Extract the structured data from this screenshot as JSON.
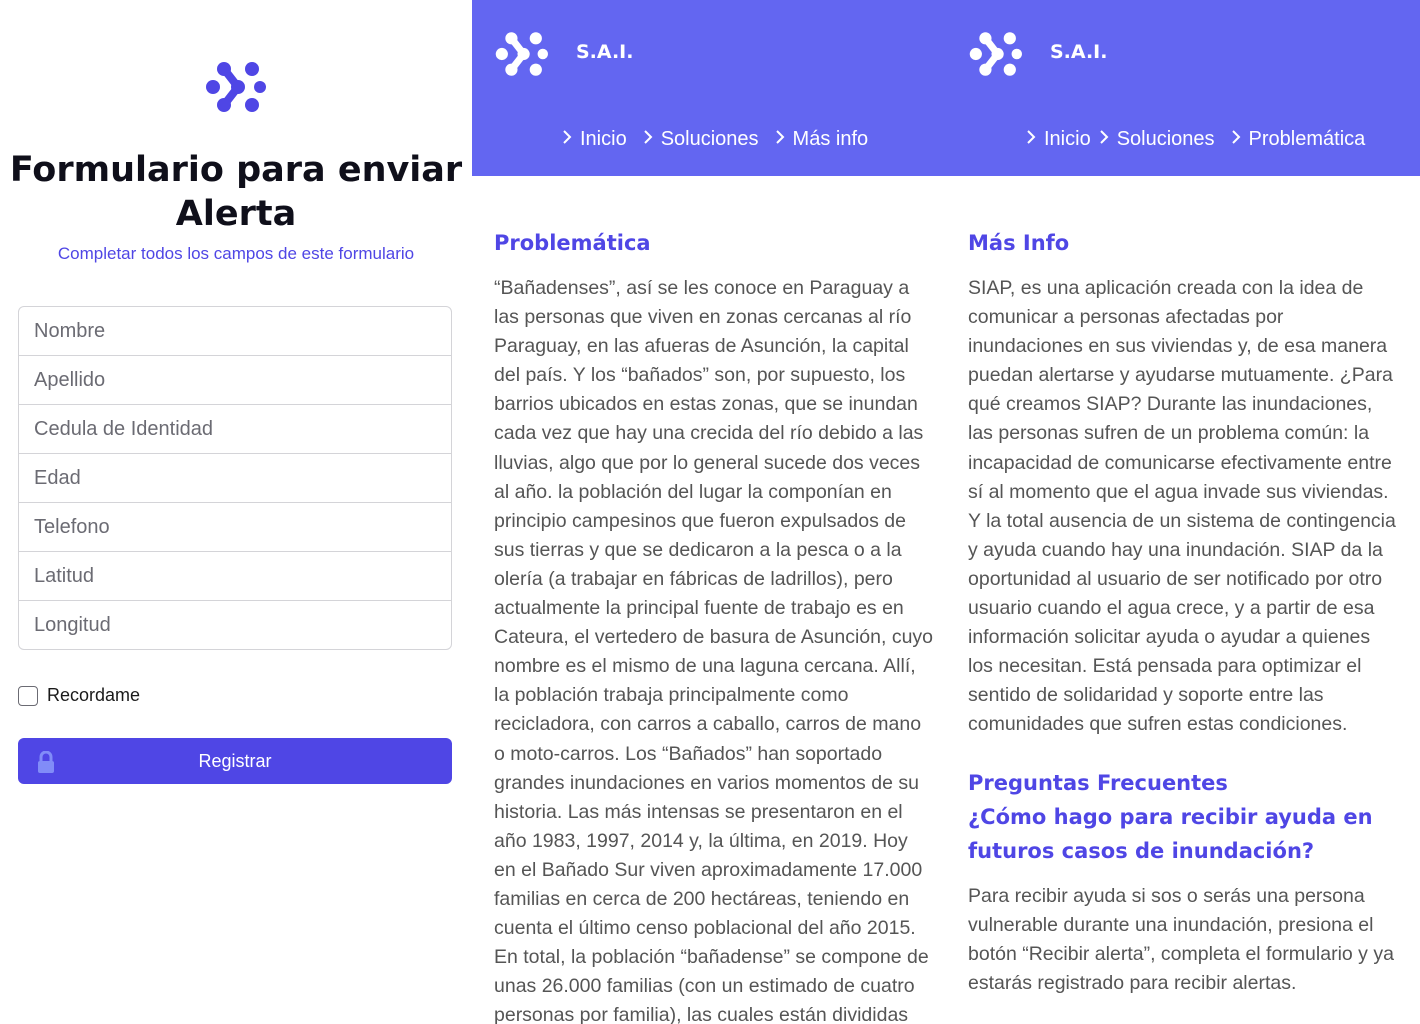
{
  "form": {
    "title": "Formulario para enviar Alerta",
    "subtitle": "Completar todos los campos de este formulario",
    "fields": [
      {
        "placeholder": "Nombre"
      },
      {
        "placeholder": "Apellido"
      },
      {
        "placeholder": "Cedula de Identidad"
      },
      {
        "placeholder": "Edad"
      },
      {
        "placeholder": "Telefono"
      },
      {
        "placeholder": "Latitud"
      },
      {
        "placeholder": "Longitud"
      }
    ],
    "remember_label": "Recordame",
    "submit_label": "Registrar",
    "icons": [
      "logo-icon",
      "lock-icon"
    ]
  },
  "problematica_page": {
    "brand": "S.A.I.",
    "nav": [
      {
        "label": "Inicio"
      },
      {
        "label": "Soluciones"
      },
      {
        "label": "Más info"
      }
    ],
    "section_title": "Problemática",
    "body": "“Bañadenses”, así se les conoce en Paraguay a las personas que viven en zonas cercanas al río Paraguay, en las afueras de Asunción, la capital del país. Y los “bañados” son, por supuesto, los barrios ubicados en estas zonas, que se inundan cada vez que hay una crecida del río debido a las lluvias, algo que por lo general sucede dos veces al año. la población del lugar la componían en principio campesinos que fueron expulsados de sus tierras y que se dedicaron a la pesca o a la olería (a trabajar en fábricas de ladrillos), pero actualmente la principal fuente de trabajo es en Cateura, el vertedero de basura de Asunción, cuyo nombre es el mismo de una laguna cercana. Allí, la población trabaja principalmente como recicladora, con carros a caballo, carros de mano o moto-carros. Los “Bañados” han soportado grandes inundaciones en varios momentos de su historia. Las más intensas se presentaron en el año 1983, 1997, 2014 y, la última, en 2019. Hoy en el Bañado Sur viven aproximadamente 17.000 familias en cerca de 200 hectáreas, teniendo en cuenta el último censo poblacional del año 2015. En total, la población “bañadense” se compone de unas 26.000 familias (con un estimado de cuatro personas por familia), las cuales están divididas en"
  },
  "masinfo_page": {
    "brand": "S.A.I.",
    "nav": [
      {
        "label": "Inicio"
      },
      {
        "label": "Soluciones"
      },
      {
        "label": "Problemática"
      }
    ],
    "section_title": "Más Info",
    "body": "SIAP, es una aplicación creada con la idea de comunicar a personas afectadas por inundaciones en sus viviendas y, de esa manera puedan alertarse y ayudarse mutuamente. ¿Para qué creamos SIAP? Durante las inundaciones, las personas sufren de un problema común: la incapacidad de comunicarse efectivamente entre sí al momento que el agua invade sus viviendas. Y la total ausencia de un sistema de contingencia y ayuda cuando hay una inundación. SIAP da la oportunidad al usuario de ser notificado por otro usuario cuando el agua crece, y a partir de esa información solicitar ayuda o ayudar a quienes los necesitan. Está pensada para optimizar el sentido de solidaridad y soporte entre las comunidades que sufren estas condiciones.",
    "faq_title": "Preguntas Frecuentes",
    "faq_question": "¿Cómo hago para recibir ayuda en futuros casos de inundación?",
    "faq_answer": "Para recibir ayuda si sos o serás una persona vulnerable durante una inundación, presiona el botón “Recibir alerta”, completa el formulario y ya estarás registrado para recibir alertas."
  },
  "colors": {
    "accent": "#4f46e5",
    "header": "#6366f1",
    "text": "#555555"
  }
}
